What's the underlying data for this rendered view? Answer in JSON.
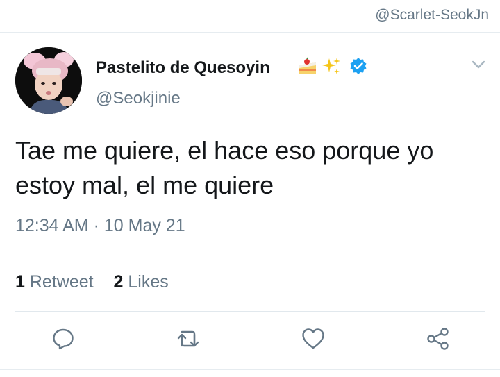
{
  "watermark": "@Scarlet-SeokJn",
  "tweet": {
    "display_name": "Pastelito de Quesoyin",
    "name_emojis": [
      "cake-emoji",
      "sparkles-emoji"
    ],
    "verified_icon": "verified-badge-icon",
    "handle": "@Seokjinie",
    "text": "Tae me quiere, el hace eso porque yo estoy mal, el me quiere",
    "time": "12:34 AM",
    "separator": "·",
    "date": "10 May 21"
  },
  "stats": {
    "retweet_count": "1",
    "retweet_label": "Retweet",
    "likes_count": "2",
    "likes_label": "Likes"
  },
  "actions": [
    {
      "name": "reply",
      "icon": "reply-icon"
    },
    {
      "name": "retweet",
      "icon": "retweet-icon"
    },
    {
      "name": "like",
      "icon": "heart-icon"
    },
    {
      "name": "share",
      "icon": "share-icon"
    }
  ],
  "colors": {
    "text_primary": "#14171a",
    "text_secondary": "#657786",
    "verified_blue": "#1da1f2",
    "divider": "#e1e8ed"
  }
}
